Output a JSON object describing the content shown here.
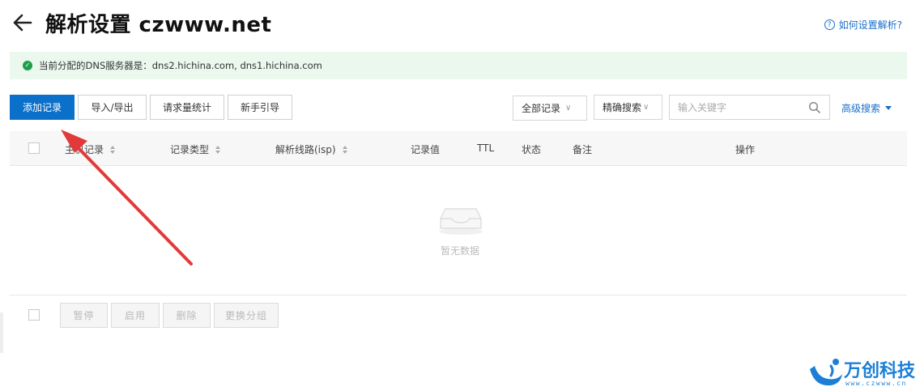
{
  "header": {
    "title": "解析设置 czwww.net",
    "help_link": "如何设置解析?"
  },
  "notice": {
    "text": "当前分配的DNS服务器是：dns2.hichina.com, dns1.hichina.com"
  },
  "toolbar": {
    "add_record": "添加记录",
    "import_export": "导入/导出",
    "request_stats": "请求量统计",
    "beginner_guide": "新手引导",
    "filter_all": "全部记录",
    "filter_exact": "精确搜索",
    "search_placeholder": "输入关键字",
    "advanced_search": "高级搜索"
  },
  "table": {
    "columns": [
      "主机记录",
      "记录类型",
      "解析线路(isp)",
      "记录值",
      "TTL",
      "状态",
      "备注",
      "操作"
    ],
    "empty_text": "暂无数据"
  },
  "footer_actions": {
    "pause": "暂停",
    "enable": "启用",
    "delete": "删除",
    "change_group": "更换分组"
  },
  "watermark": {
    "brand": "万创科技",
    "url": "www.czwww.cn"
  },
  "colors": {
    "primary": "#0a70c9",
    "link": "#1a6fc9",
    "notice_bg": "#eaf8ee",
    "success": "#1f9e4a",
    "annotation_arrow": "#e23a3a"
  },
  "icons": {
    "back": "arrow-left-icon",
    "help": "question-circle-icon",
    "notice": "check-circle-icon",
    "search": "search-icon",
    "empty": "empty-inbox-icon"
  }
}
